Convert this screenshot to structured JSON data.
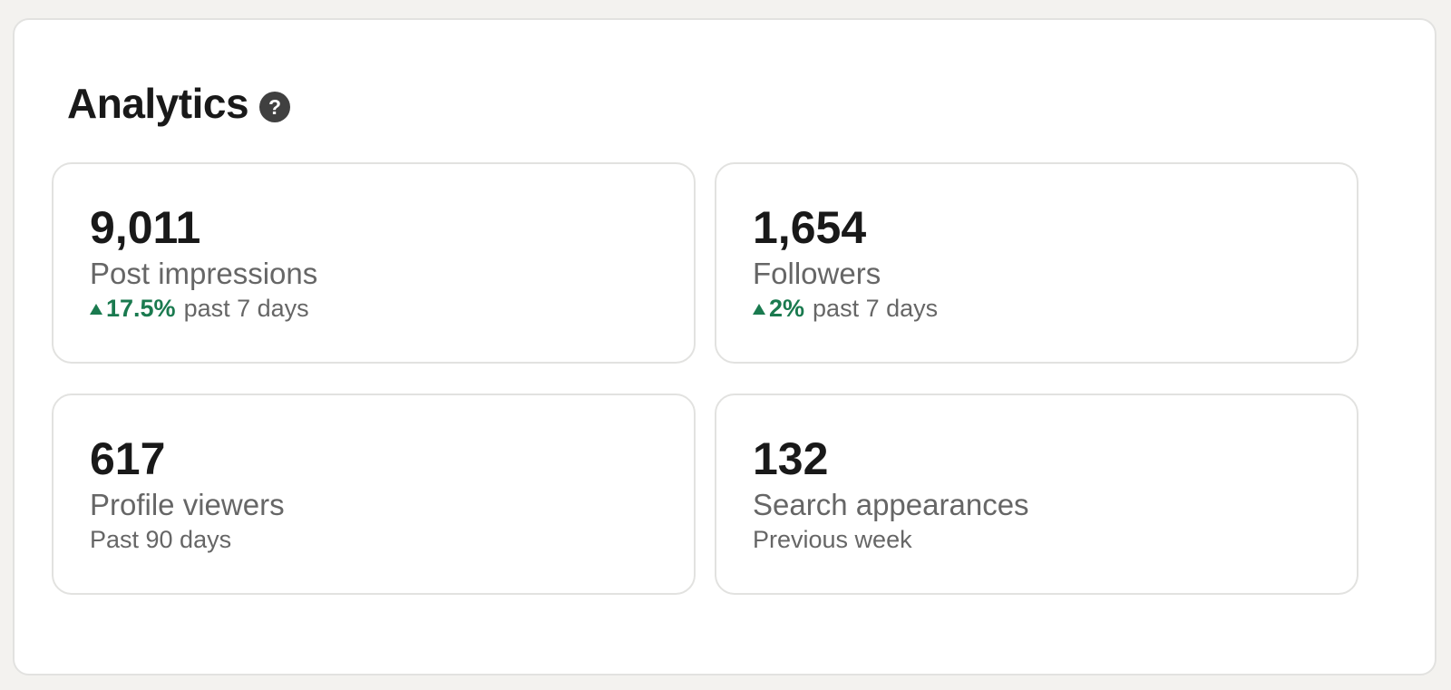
{
  "analytics": {
    "title": "Analytics",
    "help_icon_glyph": "?",
    "cards": [
      {
        "value": "9,011",
        "label": "Post impressions",
        "trend": {
          "direction": "up",
          "icon": "triangle-up-icon",
          "percent": "17.5%",
          "period": "past 7 days"
        }
      },
      {
        "value": "1,654",
        "label": "Followers",
        "trend": {
          "direction": "up",
          "icon": "triangle-up-icon",
          "percent": "2%",
          "period": "past 7 days"
        }
      },
      {
        "value": "617",
        "label": "Profile viewers",
        "period": "Past 90 days"
      },
      {
        "value": "132",
        "label": "Search appearances",
        "period": "Previous week"
      }
    ]
  },
  "colors": {
    "page_background": "#f3f2ef",
    "panel_background": "#ffffff",
    "border": "#e2e2e0",
    "heading_text": "#191919",
    "secondary_text": "#666666",
    "positive_trend": "#1a7a4f",
    "help_icon_bg": "#404040"
  }
}
